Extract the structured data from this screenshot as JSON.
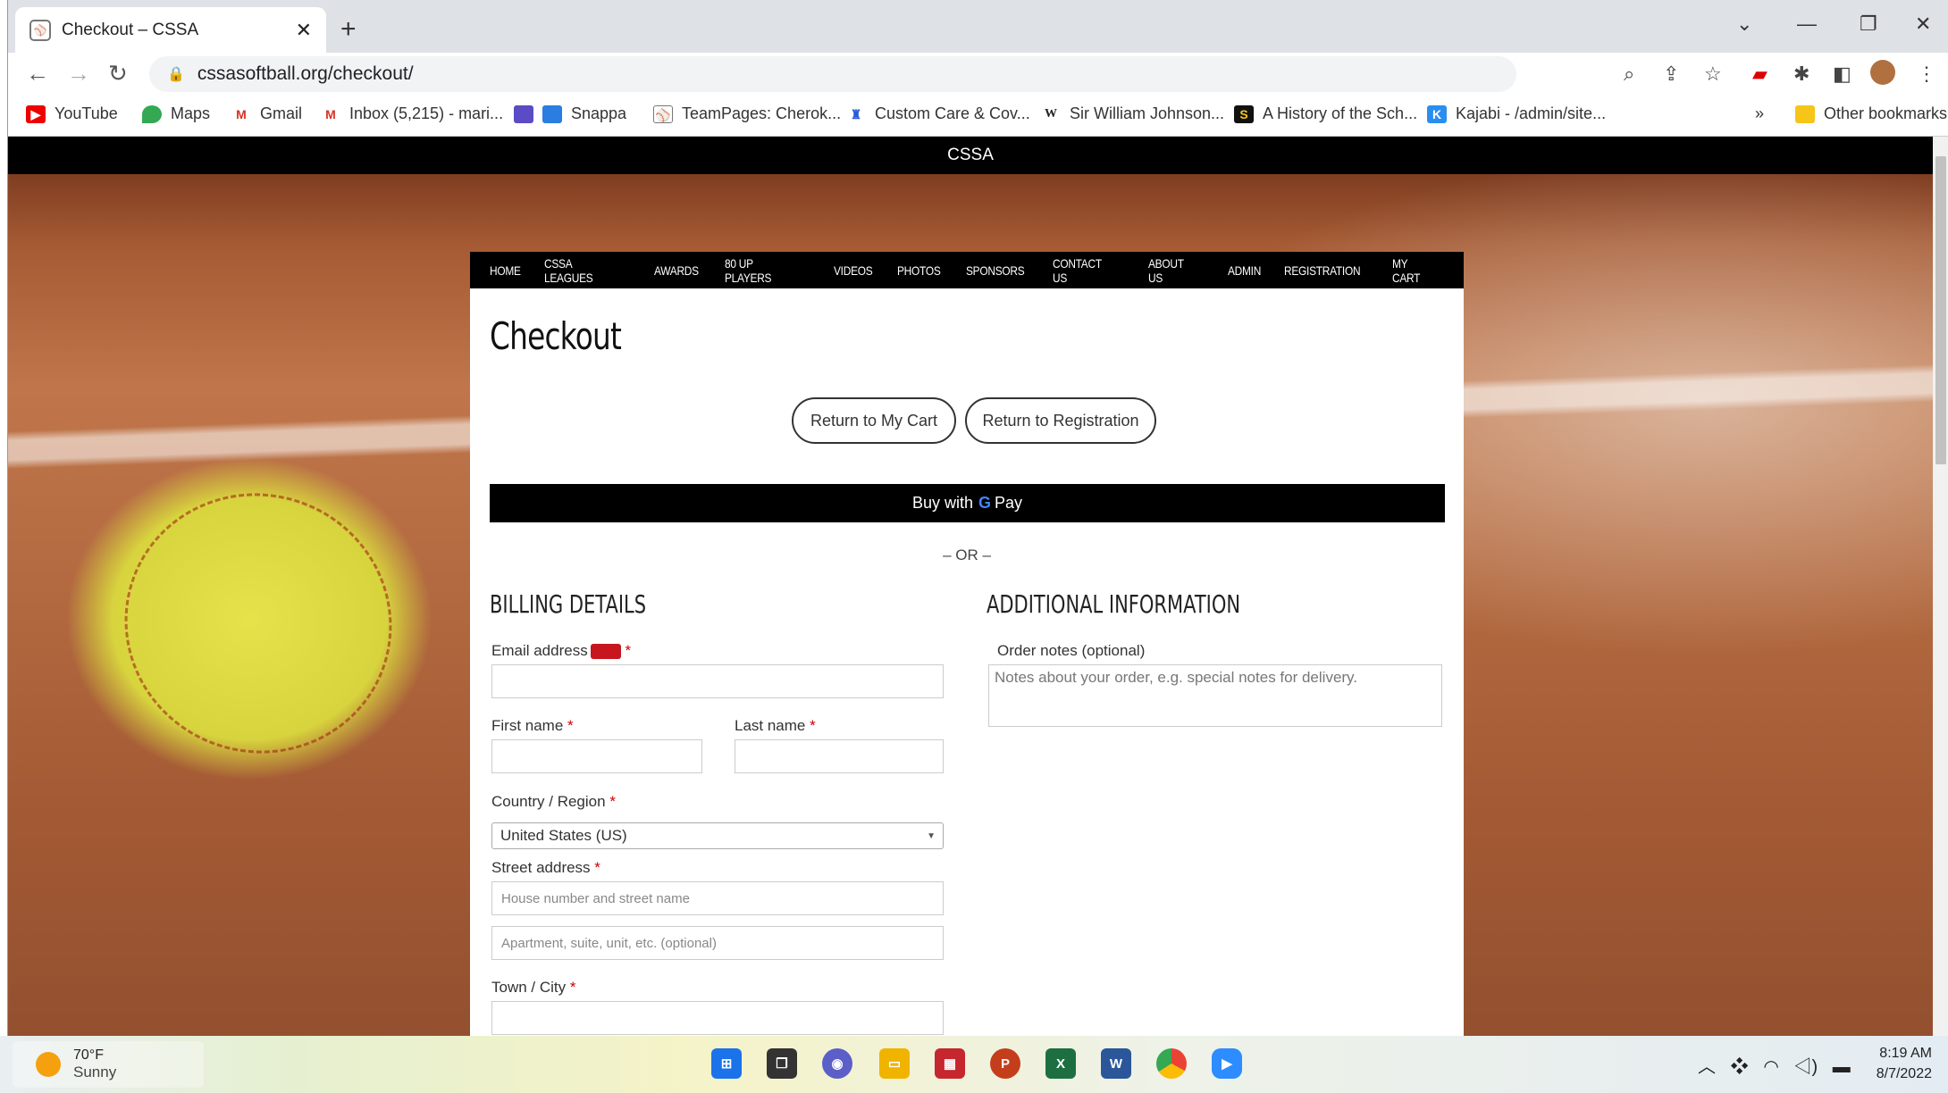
{
  "browser": {
    "tab_title": "Checkout – CSSA",
    "tab_close": "✕",
    "new_tab": "+",
    "url": "cssasoftball.org/checkout/",
    "bookmarks": [
      "YouTube",
      "Maps",
      "Gmail",
      "Inbox (5,215) - mari...",
      "Snappa",
      "TeamPages: Cherok...",
      "Custom Care & Cov...",
      "Sir William Johnson...",
      "A History of the Sch...",
      "Kajabi - /admin/site..."
    ],
    "bookmarks_more": "»",
    "other_bookmarks": "Other bookmarks"
  },
  "site": {
    "top_bar": "CSSA",
    "nav": [
      "HOME",
      "CSSA LEAGUES",
      "AWARDS",
      "80 UP PLAYERS",
      "VIDEOS",
      "PHOTOS",
      "SPONSORS",
      "CONTACT US",
      "ABOUT US",
      "ADMIN",
      "REGISTRATION",
      "MY CART"
    ]
  },
  "checkout": {
    "title": "Checkout",
    "return_cart": "Return to My Cart",
    "return_registration": "Return to Registration",
    "buy_with": "Buy with",
    "gpay_g": "G",
    "gpay_pay": "Pay",
    "or": "– OR –",
    "billing_heading": "BILLING DETAILS",
    "additional_heading": "ADDITIONAL INFORMATION",
    "email_label": "Email address",
    "first_name_label": "First name",
    "last_name_label": "Last name",
    "country_label": "Country / Region",
    "country_value": "United States (US)",
    "street_label": "Street address",
    "street_placeholder": "House number and street name",
    "apt_placeholder": "Apartment, suite, unit, etc. (optional)",
    "city_label": "Town / City",
    "notes_label": "Order notes (optional)",
    "notes_placeholder": "Notes about your order, e.g. special notes for delivery.",
    "required_mark": "*"
  },
  "taskbar": {
    "temp": "70°F",
    "condition": "Sunny",
    "time": "8:19 AM",
    "date": "8/7/2022"
  }
}
